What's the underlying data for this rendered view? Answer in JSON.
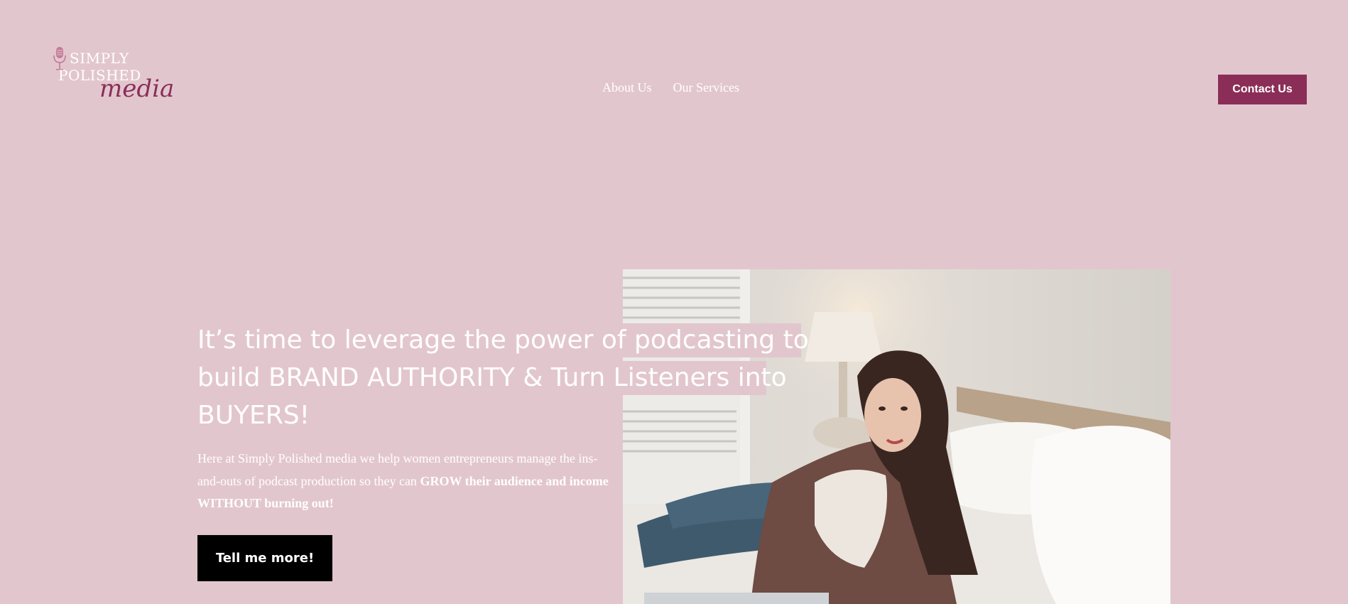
{
  "theme": {
    "background": "#e2c6ce",
    "accent": "#8b2e57",
    "button_dark": "#000000",
    "text": "#ffffff"
  },
  "logo": {
    "line1": "SIMPLY",
    "line2": "POLISHED",
    "script": "media",
    "icon": "microphone-icon"
  },
  "nav": {
    "items": [
      {
        "label": "About Us"
      },
      {
        "label": "Our Services"
      }
    ]
  },
  "header": {
    "contact_label": "Contact Us"
  },
  "hero": {
    "headline_lines": [
      "It’s time to leverage the power of podcasting to",
      "build BRAND AUTHORITY & Turn Listeners into",
      "BUYERS!"
    ],
    "lead_intro": "Here  at Simply Polished media we help women entrepreneurs manage the ins-and-outs of podcast production so they can ",
    "lead_bold": "GROW their audience and income WITHOUT burning out!",
    "cta_label": "Tell me more!"
  }
}
